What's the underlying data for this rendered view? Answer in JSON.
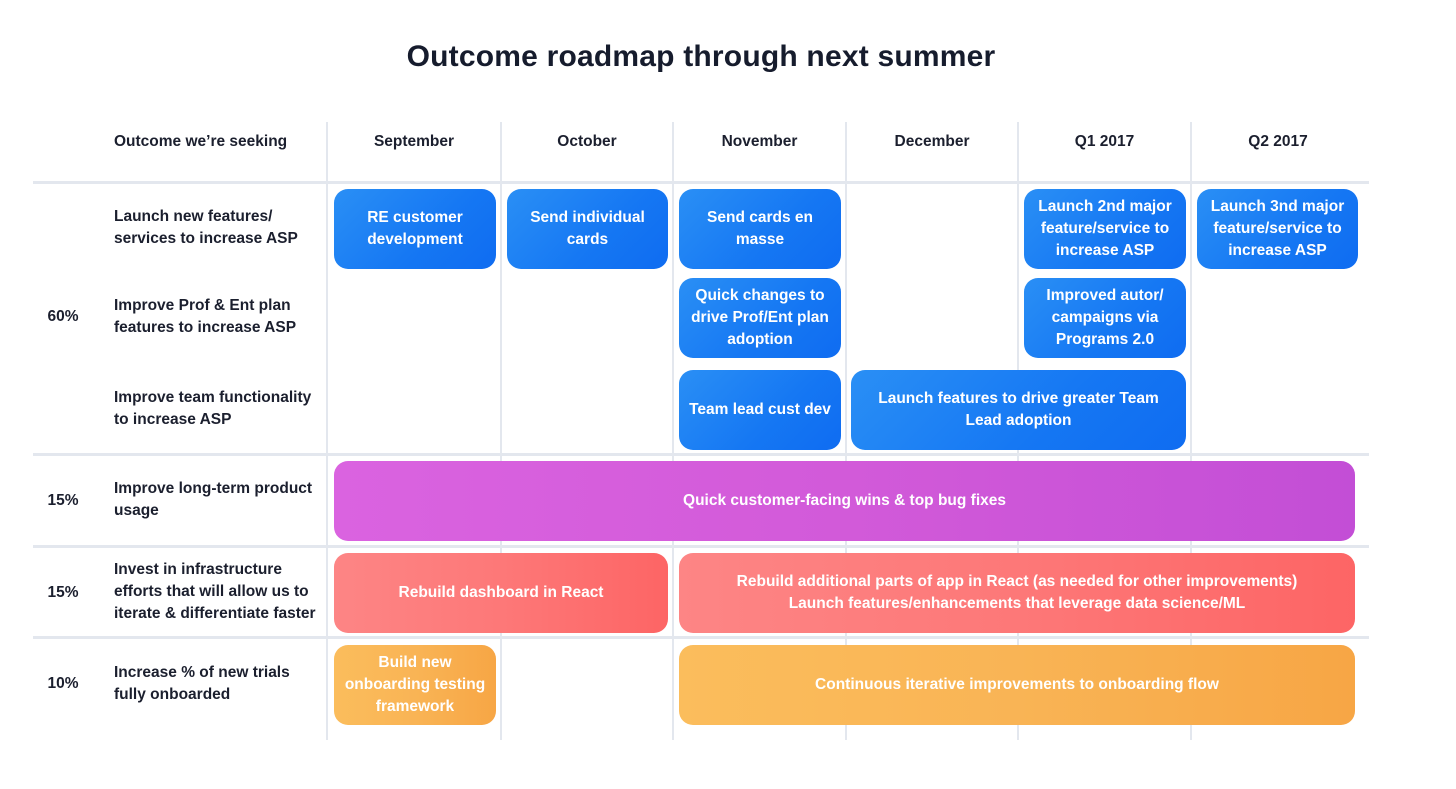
{
  "title": "Outcome roadmap through next summer",
  "header": {
    "outcome_label": "Outcome we’re seeking",
    "columns": [
      "September",
      "October",
      "November",
      "December",
      "Q1 2017",
      "Q2 2017"
    ]
  },
  "groups": [
    {
      "weight": "60%",
      "outcomes": [
        "Launch new features/\nservices to increase ASP",
        "Improve Prof & Ent plan\nfeatures to increase ASP",
        "Improve team functionality\nto increase ASP"
      ]
    },
    {
      "weight": "15%",
      "outcomes": [
        "Improve long-term product\nusage"
      ]
    },
    {
      "weight": "15%",
      "outcomes": [
        "Invest in infrastructure\nefforts that will allow us to\niterate & differentiate faster"
      ]
    },
    {
      "weight": "10%",
      "outcomes": [
        "Increase % of new trials\nfully onboarded"
      ]
    }
  ],
  "initiatives": [
    {
      "text": "RE customer\ndevelopment",
      "outcome": "Launch new features/services to increase ASP",
      "start": "September",
      "end": "September",
      "color": "#1a7ff4"
    },
    {
      "text": "Send individual\ncards",
      "outcome": "Launch new features/services to increase ASP",
      "start": "October",
      "end": "October",
      "color": "#1a7ff4"
    },
    {
      "text": "Send cards en\nmasse",
      "outcome": "Launch new features/services to increase ASP",
      "start": "November",
      "end": "November",
      "color": "#1a7ff4"
    },
    {
      "text": "Launch 2nd major\nfeature/service to\nincrease ASP",
      "outcome": "Launch new features/services to increase ASP",
      "start": "Q1 2017",
      "end": "Q1 2017",
      "color": "#1a7ff4"
    },
    {
      "text": "Launch 3nd major\nfeature/service to\nincrease ASP",
      "outcome": "Launch new features/services to increase ASP",
      "start": "Q2 2017",
      "end": "Q2 2017",
      "color": "#1a7ff4"
    },
    {
      "text": "Quick changes to\ndrive Prof/Ent plan\nadoption",
      "outcome": "Improve Prof & Ent plan features to increase ASP",
      "start": "November",
      "end": "November",
      "color": "#1a7ff4"
    },
    {
      "text": "Improved autor/\ncampaigns via\nPrograms 2.0",
      "outcome": "Improve Prof & Ent plan features to increase ASP",
      "start": "Q1 2017",
      "end": "Q1 2017",
      "color": "#1a7ff4"
    },
    {
      "text": "Team lead cust dev",
      "outcome": "Improve team functionality to increase ASP",
      "start": "November",
      "end": "November",
      "color": "#1a7ff4"
    },
    {
      "text": "Launch features to drive greater Team\nLead adoption",
      "outcome": "Improve team functionality to increase ASP",
      "start": "December",
      "end": "Q1 2017",
      "color": "#1a7ff4"
    },
    {
      "text": "Quick customer-facing wins & top bug fixes",
      "outcome": "Improve long-term product usage",
      "start": "September",
      "end": "Q2 2017",
      "color": "#d25ad9"
    },
    {
      "text": "Rebuild dashboard in React",
      "outcome": "Invest in infrastructure",
      "start": "September",
      "end": "October",
      "color": "#fd7878"
    },
    {
      "text": "Rebuild additional parts of app in React (as needed for other improvements)\nLaunch features/enhancements that leverage data science/ML",
      "outcome": "Invest in infrastructure",
      "start": "November",
      "end": "Q2 2017",
      "color": "#fd7878"
    },
    {
      "text": "Build new\nonboarding testing\nframework",
      "outcome": "Increase % of new trials fully onboarded",
      "start": "September",
      "end": "September",
      "color": "#f9b455"
    },
    {
      "text": "Continuous iterative improvements to onboarding flow",
      "outcome": "Increase % of new trials fully onboarded",
      "start": "November",
      "end": "Q2 2017",
      "color": "#f9b455"
    }
  ]
}
